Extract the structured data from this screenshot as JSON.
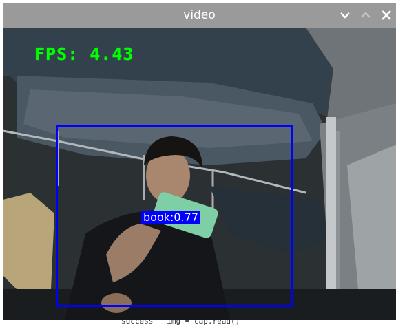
{
  "window": {
    "title": "video",
    "controls": {
      "minimize_icon": "chevron-down-icon",
      "maximize_icon": "chevron-up-icon",
      "close_icon": "close-icon"
    }
  },
  "video": {
    "fps_text": "FPS: 4.43",
    "detection": {
      "label": "book:0.77",
      "box_color": "#0000ff"
    },
    "fps_color": "#00ff00"
  },
  "background_terminal": {
    "text": "success   img = cap.read()"
  },
  "colors": {
    "titlebar": "#9a9a9a",
    "title_text": "#ffffff"
  }
}
